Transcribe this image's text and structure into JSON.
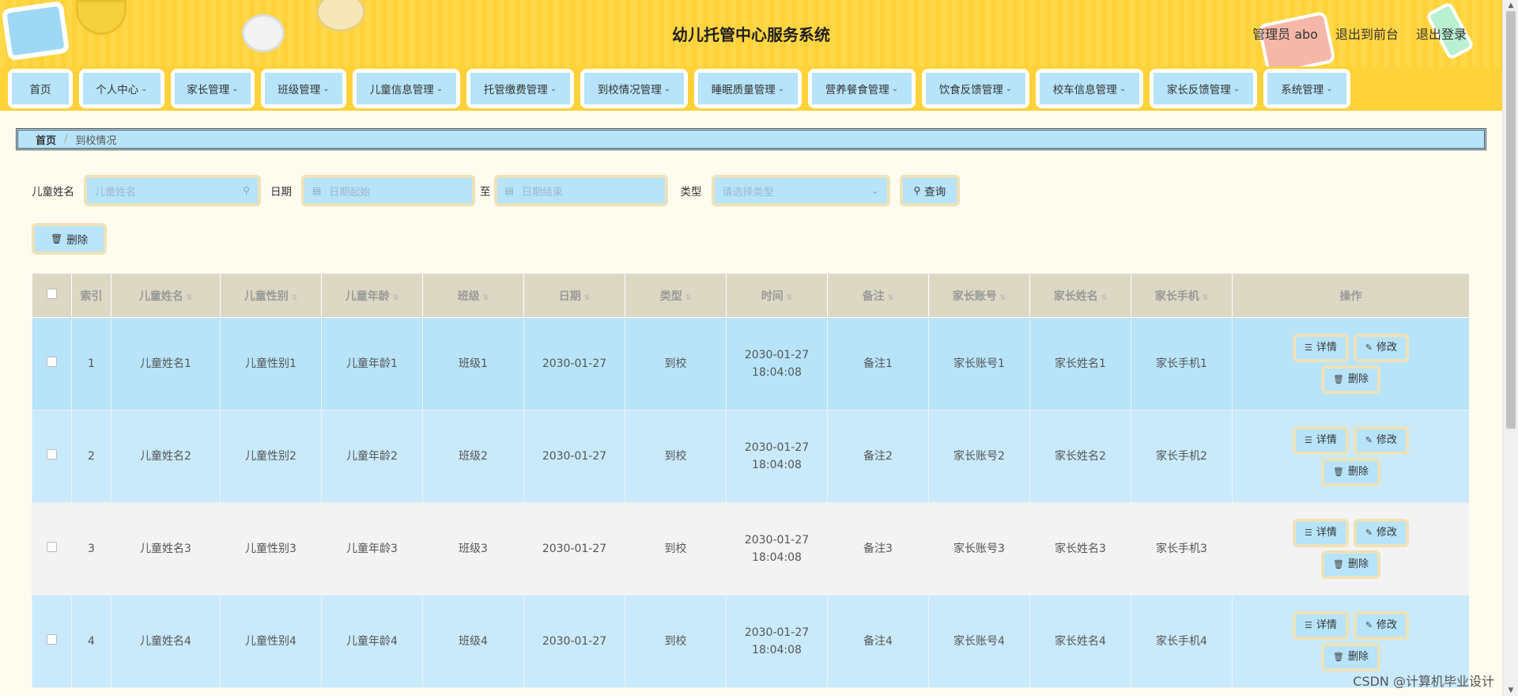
{
  "header": {
    "title": "幼儿托管中心服务系统",
    "user_label": "管理员 abo",
    "front_label": "退出到前台",
    "logout_label": "退出登录"
  },
  "nav": {
    "items": [
      {
        "label": "首页",
        "dropdown": false
      },
      {
        "label": "个人中心",
        "dropdown": true
      },
      {
        "label": "家长管理",
        "dropdown": true
      },
      {
        "label": "班级管理",
        "dropdown": true
      },
      {
        "label": "儿童信息管理",
        "dropdown": true
      },
      {
        "label": "托管缴费管理",
        "dropdown": true
      },
      {
        "label": "到校情况管理",
        "dropdown": true
      },
      {
        "label": "睡眠质量管理",
        "dropdown": true
      },
      {
        "label": "营养餐食管理",
        "dropdown": true
      },
      {
        "label": "饮食反馈管理",
        "dropdown": true
      },
      {
        "label": "校车信息管理",
        "dropdown": true
      },
      {
        "label": "家长反馈管理",
        "dropdown": true
      },
      {
        "label": "系统管理",
        "dropdown": true
      }
    ]
  },
  "breadcrumb": {
    "home": "首页",
    "separator": "/",
    "current": "到校情况"
  },
  "search": {
    "name_label": "儿童姓名",
    "name_placeholder": "儿童姓名",
    "date_label": "日期",
    "date_start_placeholder": "日期起始",
    "date_to": "至",
    "date_end_placeholder": "日期结束",
    "type_label": "类型",
    "type_placeholder": "请选择类型",
    "search_button": "查询"
  },
  "actions": {
    "delete_button": "删除"
  },
  "table": {
    "columns": [
      "索引",
      "儿童姓名",
      "儿童性别",
      "儿童年龄",
      "班级",
      "日期",
      "类型",
      "时间",
      "备注",
      "家长账号",
      "家长姓名",
      "家长手机",
      "操作"
    ],
    "sortable": [
      false,
      true,
      true,
      true,
      true,
      true,
      true,
      true,
      true,
      true,
      true,
      true,
      false
    ],
    "rows": [
      {
        "index": "1",
        "name": "儿童姓名1",
        "gender": "儿童性别1",
        "age": "儿童年龄1",
        "class": "班级1",
        "date": "2030-01-27",
        "type": "到校",
        "time": "2030-01-27 18:04:08",
        "note": "备注1",
        "parent_account": "家长账号1",
        "parent_name": "家长姓名1",
        "parent_phone": "家长手机1"
      },
      {
        "index": "2",
        "name": "儿童姓名2",
        "gender": "儿童性别2",
        "age": "儿童年龄2",
        "class": "班级2",
        "date": "2030-01-27",
        "type": "到校",
        "time": "2030-01-27 18:04:08",
        "note": "备注2",
        "parent_account": "家长账号2",
        "parent_name": "家长姓名2",
        "parent_phone": "家长手机2"
      },
      {
        "index": "3",
        "name": "儿童姓名3",
        "gender": "儿童性别3",
        "age": "儿童年龄3",
        "class": "班级3",
        "date": "2030-01-27",
        "type": "到校",
        "time": "2030-01-27 18:04:08",
        "note": "备注3",
        "parent_account": "家长账号3",
        "parent_name": "家长姓名3",
        "parent_phone": "家长手机3"
      },
      {
        "index": "4",
        "name": "儿童姓名4",
        "gender": "儿童性别4",
        "age": "儿童年龄4",
        "class": "班级4",
        "date": "2030-01-27",
        "type": "到校",
        "time": "2030-01-27 18:04:08",
        "note": "备注4",
        "parent_account": "家长账号4",
        "parent_name": "家长姓名4",
        "parent_phone": "家长手机4"
      }
    ],
    "row_actions": {
      "detail": "详情",
      "edit": "修改",
      "delete": "删除"
    }
  },
  "watermark": "CSDN @计算机毕业设计",
  "colors": {
    "header_yellow": "#ffd84a",
    "button_blue": "#b7e4f9",
    "button_frame": "#eee2b8",
    "header_cell": "#dcd8c3"
  }
}
